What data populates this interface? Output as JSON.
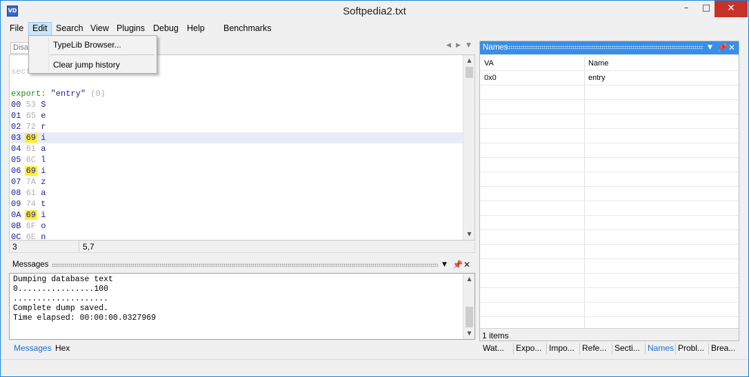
{
  "window": {
    "title": "Softpedia2.txt",
    "app_icon": "VD",
    "minimize": "–",
    "maximize": "□",
    "close": "✕"
  },
  "menu": [
    "File",
    "Edit",
    "Search",
    "View",
    "Plugins",
    "Debug",
    "Help",
    "Benchmarks"
  ],
  "edit_menu": {
    "items": [
      "TypeLib Browser...",
      "Clear jump history"
    ]
  },
  "disassembly": {
    "tab_label": "Disas",
    "section_label": "sect",
    "export_keyword": "export:",
    "export_name": "\"entry\"",
    "export_index": "(0)",
    "rows": [
      {
        "addr": "00",
        "hex": "53",
        "ch": "S",
        "mark": false
      },
      {
        "addr": "01",
        "hex": "65",
        "ch": "e",
        "mark": false
      },
      {
        "addr": "02",
        "hex": "72",
        "ch": "r",
        "mark": false
      },
      {
        "addr": "03",
        "hex": "69",
        "ch": "i",
        "mark": true
      },
      {
        "addr": "04",
        "hex": "61",
        "ch": "a",
        "mark": false
      },
      {
        "addr": "05",
        "hex": "6C",
        "ch": "l",
        "mark": false
      },
      {
        "addr": "06",
        "hex": "69",
        "ch": "i",
        "mark": true
      },
      {
        "addr": "07",
        "hex": "7A",
        "ch": "z",
        "mark": false
      },
      {
        "addr": "08",
        "hex": "61",
        "ch": "a",
        "mark": false
      },
      {
        "addr": "09",
        "hex": "74",
        "ch": "t",
        "mark": false
      },
      {
        "addr": "0A",
        "hex": "69",
        "ch": "i",
        "mark": true
      },
      {
        "addr": "0B",
        "hex": "6F",
        "ch": "o",
        "mark": false
      },
      {
        "addr": "0C",
        "hex": "6E",
        "ch": "n",
        "mark": false
      }
    ],
    "status_left": "3",
    "status_right": "5,7"
  },
  "messages": {
    "title": "Messages",
    "lines": [
      "Dumping database text",
      "0................100",
      "....................",
      "Complete dump saved.",
      "Time elapsed: 00:00:00.0327969"
    ]
  },
  "left_bottom_tabs": [
    "Messages",
    "Hex"
  ],
  "names": {
    "title": "Names",
    "columns": [
      "VA",
      "Name"
    ],
    "rows": [
      {
        "va": "0x0",
        "name": "entry"
      }
    ],
    "footer": "1 items"
  },
  "right_bottom_tabs": [
    "Wat...",
    "Expo...",
    "Impo...",
    "Refe...",
    "Secti...",
    "Names",
    "Probl...",
    "Brea..."
  ]
}
